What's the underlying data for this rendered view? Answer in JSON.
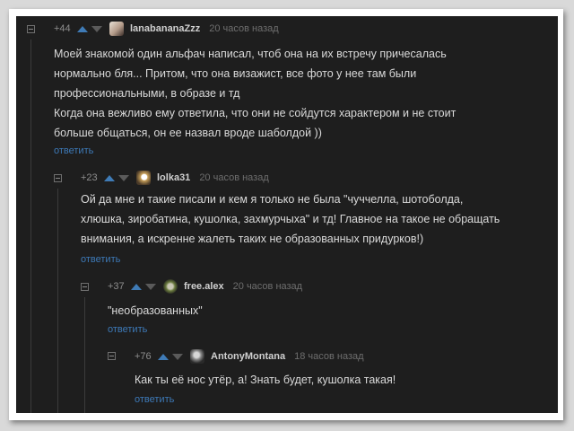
{
  "comments": [
    {
      "rating": "+44",
      "username": "lanabananaZzz",
      "time": "20 часов назад",
      "lines": [
        "Моей знакомой один альфач написал, чтоб она на их встречу причесалась",
        "нормально бля... Притом, что она визажист, все фото у нее там были",
        "профессиональными, в образе и тд",
        "Когда она вежливо ему ответила, что они не сойдутся характером и не стоит",
        "больше общаться, он ее назвал вроде шаболдой ))"
      ],
      "reply_label": "ответить"
    },
    {
      "rating": "+23",
      "username": "lolka31",
      "time": "20 часов назад",
      "lines": [
        "Ой да мне и такие писали и кем я только не была \"чуччелла, шотоболда,",
        "хлюшка, зиробатина, кушолка, захмурчыха\" и тд! Главное на такое не обращать",
        "внимания, а искренне жалеть таких не образованных придурков!)"
      ],
      "reply_label": "ответить"
    },
    {
      "rating": "+37",
      "username": "free.alex",
      "time": "20 часов назад",
      "lines": [
        "\"необразованных\""
      ],
      "reply_label": "ответить"
    },
    {
      "rating": "+76",
      "username": "AntonyMontana",
      "time": "18 часов назад",
      "lines": [
        "Как ты её нос утёр, а! Знать будет, кушолка такая!"
      ],
      "reply_label": "ответить"
    }
  ],
  "colors": {
    "background": "#1e1e1e",
    "text": "#dadada",
    "link": "#3d79b7",
    "upvote": "#3f7bb6"
  }
}
